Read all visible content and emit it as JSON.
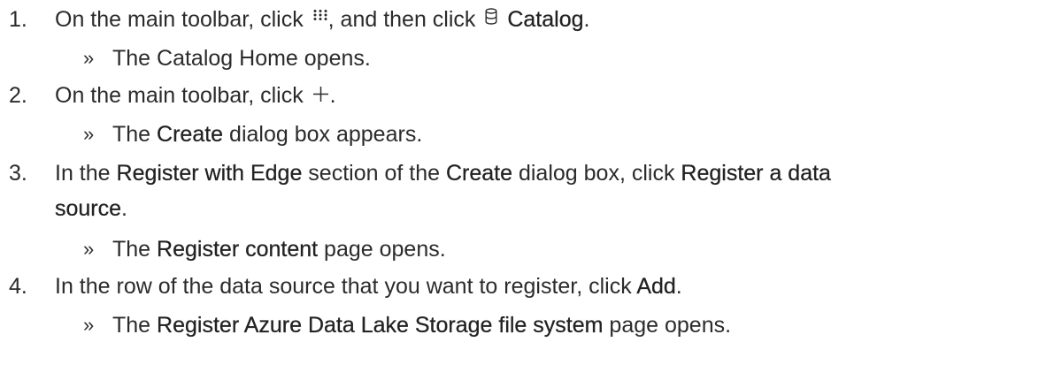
{
  "steps": [
    {
      "num": "1.",
      "text_a": "On the main toolbar, click",
      "text_b": ", and then click",
      "catalog_label": "Catalog",
      "text_c": ".",
      "result_prefix": "»",
      "result_text": "The Catalog Home opens."
    },
    {
      "num": "2.",
      "text_a": "On the main toolbar, click",
      "text_b": ".",
      "result_prefix": "»",
      "result_a": "The",
      "result_bold": "Create",
      "result_b": "dialog box appears."
    },
    {
      "num": "3.",
      "text_a": "In the",
      "bold_1": "Register with Edge",
      "text_b": "section of the",
      "bold_2": "Create",
      "text_c": "dialog box, click",
      "bold_3": "Register a data",
      "bold_3_cont": "source",
      "text_d": ".",
      "result_prefix": "»",
      "result_a": "The",
      "result_bold": "Register content",
      "result_b": "page opens."
    },
    {
      "num": "4.",
      "text_a": "In the row of the data source that you want to register, click",
      "bold_1": "Add",
      "text_b": ".",
      "result_prefix": "»",
      "result_a": "The",
      "result_bold": "Register Azure Data Lake Storage file system",
      "result_b": "page opens."
    }
  ],
  "icons": {
    "apps": "apps-grid-icon",
    "catalog": "database-icon",
    "plus": "plus-icon"
  }
}
